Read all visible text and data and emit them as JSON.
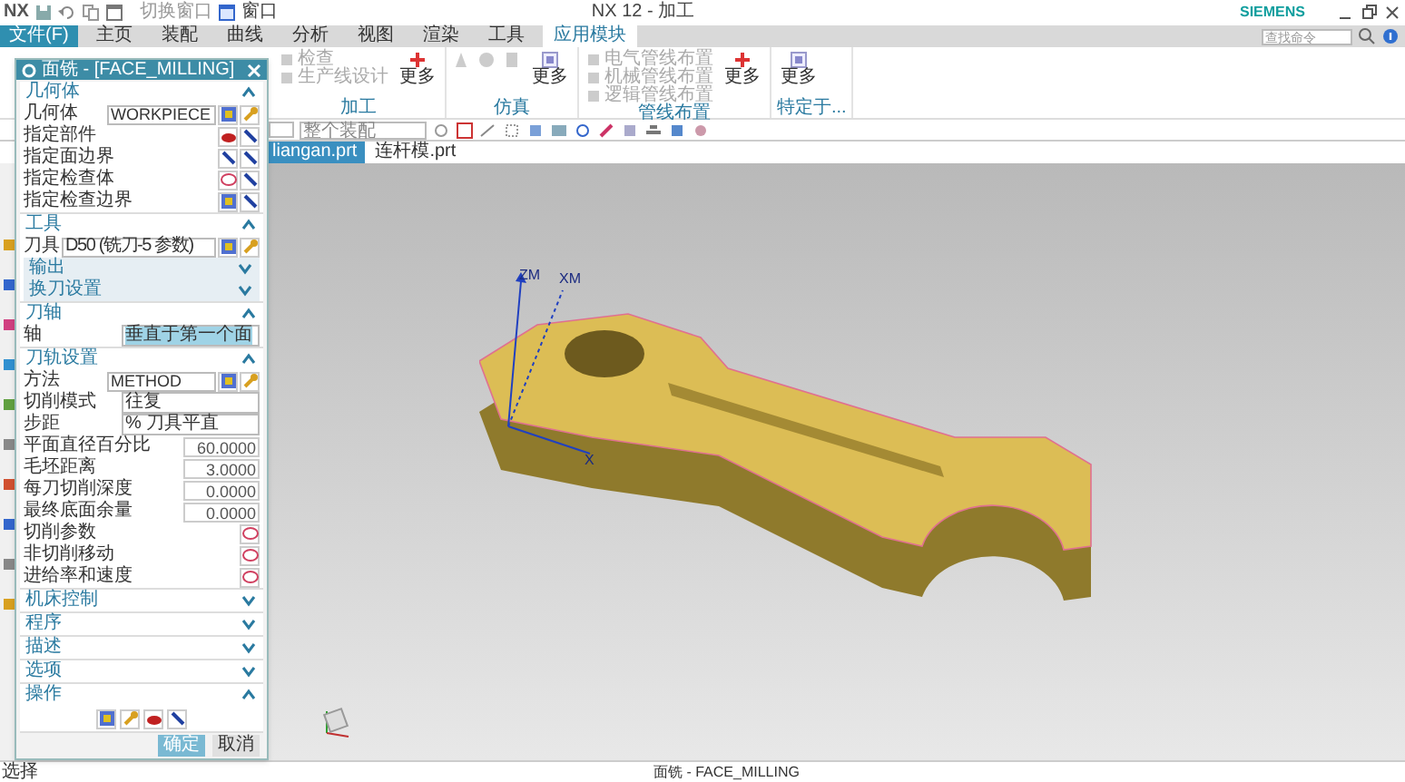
{
  "title_bar": {
    "logo": "NX",
    "quick_access": [
      "切换窗口",
      "窗口"
    ],
    "title": "NX 12 - 加工",
    "brand": "SIEMENS"
  },
  "menu_tabs": [
    {
      "label": "文件(F)",
      "kind": "file"
    },
    {
      "label": "主页",
      "kind": "tab",
      "selected": false
    },
    {
      "label": "装配",
      "kind": "tab",
      "selected": false
    },
    {
      "label": "曲线",
      "kind": "tab",
      "selected": false
    },
    {
      "label": "分析",
      "kind": "tab",
      "selected": false
    },
    {
      "label": "视图",
      "kind": "tab",
      "selected": false
    },
    {
      "label": "渲染",
      "kind": "tab",
      "selected": false
    },
    {
      "label": "工具",
      "kind": "tab",
      "selected": false
    },
    {
      "label": "应用模块",
      "kind": "tab",
      "selected": true
    }
  ],
  "search": {
    "placeholder": "查找命令"
  },
  "ribbon_groups": [
    {
      "label": "加工",
      "kind": "list",
      "items": [
        "检查",
        "生产线设计"
      ],
      "more": "更多"
    },
    {
      "label": "仿真",
      "kind": "icons",
      "more": "更多"
    },
    {
      "label": "管线布置",
      "kind": "list",
      "items": [
        "电气管线布置",
        "机械管线布置",
        "逻辑管线布置"
      ],
      "more": "更多"
    },
    {
      "label": "特定于...",
      "kind": "single",
      "more": "更多"
    }
  ],
  "toolbar": {
    "assembly_scope": "整个装配"
  },
  "documents": [
    {
      "label": "liangan.prt",
      "selected": true
    },
    {
      "label": "连杆模.prt",
      "selected": false
    }
  ],
  "triad": [
    "ZM",
    "XM",
    "X"
  ],
  "dialog": {
    "title": "面铣 - [FACE_MILLING]",
    "sections": [
      {
        "title": "几何体",
        "expanded": true,
        "rows": [
          {
            "kind": "dropdown",
            "label": "几何体",
            "value": "WORKPIECE"
          },
          {
            "kind": "select",
            "label": "指定部件"
          },
          {
            "kind": "select",
            "label": "指定面边界"
          },
          {
            "kind": "select",
            "label": "指定检查体"
          },
          {
            "kind": "select",
            "label": "指定检查边界"
          }
        ]
      },
      {
        "title": "工具",
        "expanded": true,
        "rows": [
          {
            "kind": "dropdown",
            "label": "刀具",
            "value": "D50 (铣刀-5 参数)"
          },
          {
            "kind": "subsection",
            "label": "输出"
          },
          {
            "kind": "subsection",
            "label": "换刀设置"
          }
        ]
      },
      {
        "title": "刀轴",
        "expanded": true,
        "rows": [
          {
            "kind": "combo",
            "label": "轴",
            "value": "垂直于第一个面",
            "highlighted": true
          }
        ]
      },
      {
        "title": "刀轨设置",
        "expanded": true,
        "rows": [
          {
            "kind": "dropdown",
            "label": "方法",
            "value": "METHOD"
          },
          {
            "kind": "combo",
            "label": "切削模式",
            "value": "往复",
            "highlighted": false
          },
          {
            "kind": "combo",
            "label": "步距",
            "value": "% 刀具平直",
            "highlighted": false
          },
          {
            "kind": "number",
            "label": "平面直径百分比",
            "value": "60.0000"
          },
          {
            "kind": "number",
            "label": "毛坯距离",
            "value": "3.0000"
          },
          {
            "kind": "number",
            "label": "每刀切削深度",
            "value": "0.0000"
          },
          {
            "kind": "number",
            "label": "最终底面余量",
            "value": "0.0000"
          },
          {
            "kind": "action",
            "label": "切削参数"
          },
          {
            "kind": "action",
            "label": "非切削移动"
          },
          {
            "kind": "action",
            "label": "进给率和速度"
          }
        ]
      },
      {
        "title": "机床控制",
        "expanded": false
      },
      {
        "title": "程序",
        "expanded": false
      },
      {
        "title": "描述",
        "expanded": false
      },
      {
        "title": "选项",
        "expanded": false
      },
      {
        "title": "操作",
        "expanded": true,
        "rows": [
          {
            "kind": "operations"
          }
        ]
      }
    ],
    "buttons": [
      {
        "label": "确定",
        "kind": "primary"
      },
      {
        "label": "取消",
        "kind": "secondary"
      }
    ]
  },
  "status_bar": {
    "left": "选择",
    "center": "面铣 - FACE_MILLING"
  }
}
